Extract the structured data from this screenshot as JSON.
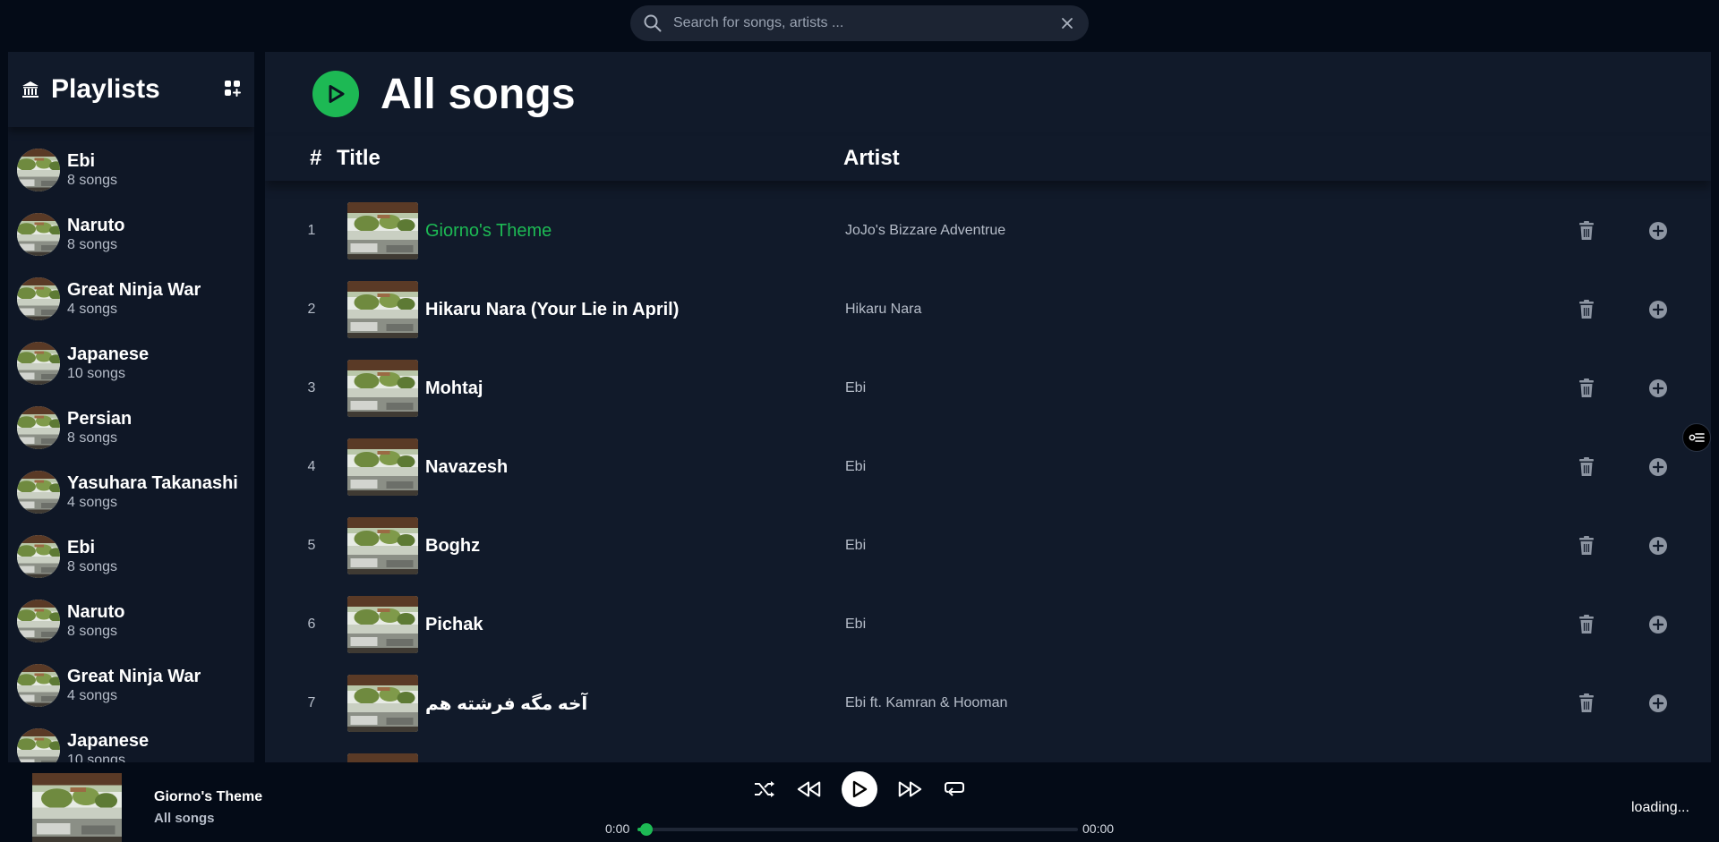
{
  "search": {
    "placeholder": "Search for songs, artists ..."
  },
  "sidebar": {
    "title": "Playlists",
    "items": [
      {
        "name": "Ebi",
        "count": "8 songs"
      },
      {
        "name": "Naruto",
        "count": "8 songs"
      },
      {
        "name": "Great Ninja War",
        "count": "4 songs"
      },
      {
        "name": "Japanese",
        "count": "10 songs"
      },
      {
        "name": "Persian",
        "count": "8 songs"
      },
      {
        "name": "Yasuhara Takanashi",
        "count": "4 songs"
      },
      {
        "name": "Ebi",
        "count": "8 songs"
      },
      {
        "name": "Naruto",
        "count": "8 songs"
      },
      {
        "name": "Great Ninja War",
        "count": "4 songs"
      },
      {
        "name": "Japanese",
        "count": "10 songs"
      }
    ]
  },
  "main": {
    "title": "All songs",
    "columns": {
      "number": "#",
      "title": "Title",
      "artist": "Artist"
    },
    "songs": [
      {
        "num": "1",
        "title": "Giorno's Theme",
        "artist": "JoJo's Bizzare Adventrue",
        "active": true
      },
      {
        "num": "2",
        "title": "Hikaru Nara (Your Lie in April)",
        "artist": "Hikaru Nara",
        "active": false
      },
      {
        "num": "3",
        "title": "Mohtaj",
        "artist": "Ebi",
        "active": false
      },
      {
        "num": "4",
        "title": "Navazesh",
        "artist": "Ebi",
        "active": false
      },
      {
        "num": "5",
        "title": "Boghz",
        "artist": "Ebi",
        "active": false
      },
      {
        "num": "6",
        "title": "Pichak",
        "artist": "Ebi",
        "active": false
      },
      {
        "num": "7",
        "title": "آخه مگه فرشته هم",
        "artist": "Ebi ft. Kamran & Hooman",
        "active": false
      }
    ]
  },
  "player": {
    "title": "Giorno's Theme",
    "subtitle": "All songs",
    "time_current": "0:00",
    "time_total": "00:00",
    "progress": 0.02,
    "status": "loading..."
  },
  "colors": {
    "accent": "#1db954",
    "background": "#040b17",
    "panel": "#111a2a",
    "sidebar": "#0f1726"
  },
  "icons": {
    "search": "search-icon",
    "clear": "close-icon",
    "library": "library-icon",
    "add_playlist": "grid-add-icon",
    "play": "play-icon",
    "delete": "trash-icon",
    "add": "plus-circle-icon",
    "shuffle": "shuffle-icon",
    "prev": "rewind-icon",
    "next": "fast-forward-icon",
    "repeat": "repeat-icon",
    "queue": "queue-icon"
  }
}
